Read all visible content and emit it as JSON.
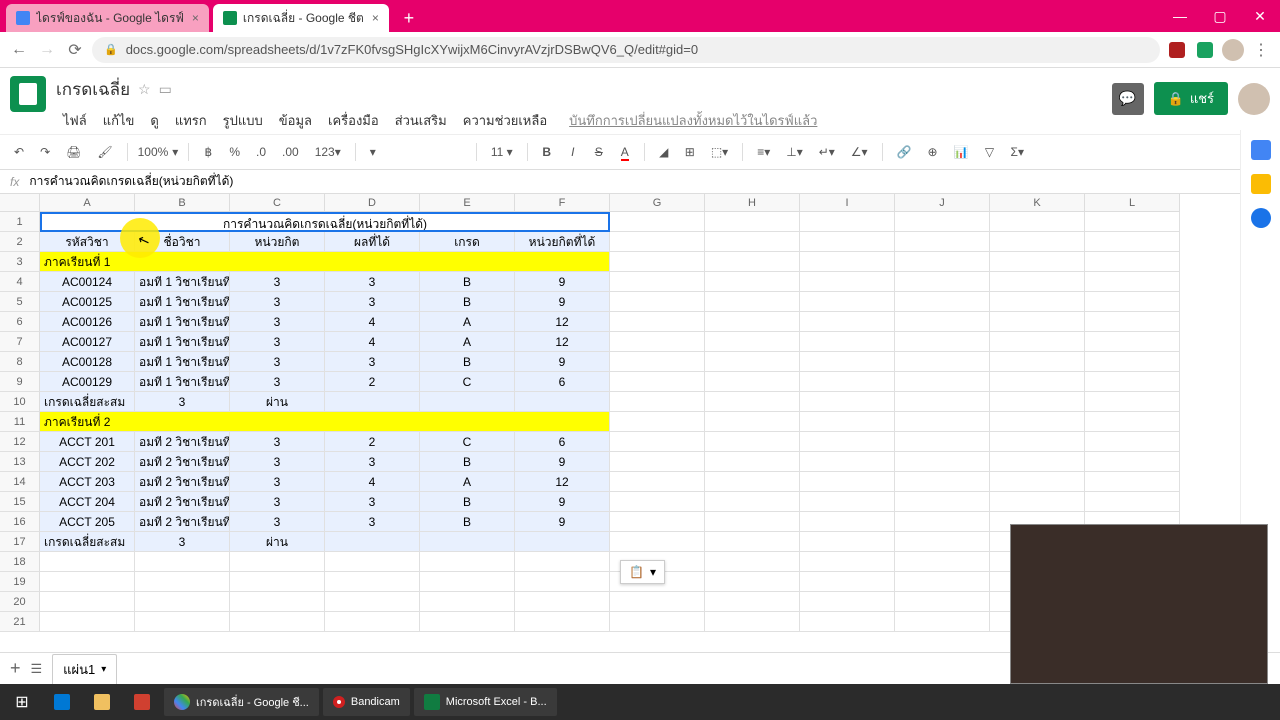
{
  "tabs": [
    {
      "title": "ไดรฟ์ของฉัน - Google ไดรฟ์"
    },
    {
      "title": "เกรดเฉลี่ย - Google ชีต"
    }
  ],
  "url": "docs.google.com/spreadsheets/d/1v7zFK0fvsgSHgIcXYwijxM6CinvyrAVzjrDSBwQV6_Q/edit#gid=0",
  "doc": {
    "title": "เกรดเฉลี่ย"
  },
  "menu": {
    "file": "ไฟล์",
    "edit": "แก้ไข",
    "view": "ดู",
    "insert": "แทรก",
    "format": "รูปแบบ",
    "data": "ข้อมูล",
    "tools": "เครื่องมือ",
    "addons": "ส่วนเสริม",
    "help": "ความช่วยเหลือ",
    "saved": "บันทึกการเปลี่ยนแปลงทั้งหมดไว้ในไดรฟ์แล้ว"
  },
  "share": "แชร์",
  "toolbar": {
    "zoom": "100%",
    "font_size": "11",
    "currency": "฿",
    "percent": "%",
    "dec0": ".0",
    "dec00": ".00",
    "num": "123"
  },
  "fx": "การคำนวณคิดเกรดเฉลี่ย(หน่วยกิตที่ได้)",
  "cols": [
    "A",
    "B",
    "C",
    "D",
    "E",
    "F",
    "G",
    "H",
    "I",
    "J",
    "K",
    "L"
  ],
  "title_row": "การคำนวณคิดเกรดเฉลี่ย(หน่วยกิตที่ได้)",
  "headers": {
    "a": "รหัสวิชา",
    "b": "ชื่อวิชา",
    "c": "หน่วยกิต",
    "d": "ผลที่ได้",
    "e": "เกรด",
    "f": "หน่วยกิตที่ได้"
  },
  "sem1": "ภาคเรียนที่ 1",
  "sem2": "ภาคเรียนที่ 2",
  "sum_label": "เกรดเฉลี่ยสะสม",
  "pass": "ผ่าน",
  "rows1": [
    {
      "a": "AC00124",
      "b": "อมที 1 วิชาเรียนที",
      "c": "3",
      "d": "3",
      "e": "B",
      "f": "9"
    },
    {
      "a": "AC00125",
      "b": "อมที 1 วิชาเรียนที",
      "c": "3",
      "d": "3",
      "e": "B",
      "f": "9"
    },
    {
      "a": "AC00126",
      "b": "อมที 1 วิชาเรียนที",
      "c": "3",
      "d": "4",
      "e": "A",
      "f": "12"
    },
    {
      "a": "AC00127",
      "b": "อมที 1 วิชาเรียนที",
      "c": "3",
      "d": "4",
      "e": "A",
      "f": "12"
    },
    {
      "a": "AC00128",
      "b": "อมที 1 วิชาเรียนที",
      "c": "3",
      "d": "3",
      "e": "B",
      "f": "9"
    },
    {
      "a": "AC00129",
      "b": "อมที 1 วิชาเรียนที",
      "c": "3",
      "d": "2",
      "e": "C",
      "f": "6"
    }
  ],
  "sum1": {
    "b": "3",
    "c": "ผ่าน"
  },
  "rows2": [
    {
      "a": "ACCT 201",
      "b": "อมที 2 วิชาเรียนที",
      "c": "3",
      "d": "2",
      "e": "C",
      "f": "6"
    },
    {
      "a": "ACCT 202",
      "b": "อมที 2 วิชาเรียนที",
      "c": "3",
      "d": "3",
      "e": "B",
      "f": "9"
    },
    {
      "a": "ACCT 203",
      "b": "อมที 2 วิชาเรียนที",
      "c": "3",
      "d": "4",
      "e": "A",
      "f": "12"
    },
    {
      "a": "ACCT 204",
      "b": "อมที 2 วิชาเรียนที",
      "c": "3",
      "d": "3",
      "e": "B",
      "f": "9"
    },
    {
      "a": "ACCT 205",
      "b": "อมที 2 วิชาเรียนที",
      "c": "3",
      "d": "3",
      "e": "B",
      "f": "9"
    }
  ],
  "sum2": {
    "b": "3",
    "c": "ผ่าน"
  },
  "sheet": "แผ่น1",
  "task": {
    "chrome": "เกรดเฉลี่ย - Google ชี...",
    "bandicam": "Bandicam",
    "excel": "Microsoft Excel - B..."
  }
}
